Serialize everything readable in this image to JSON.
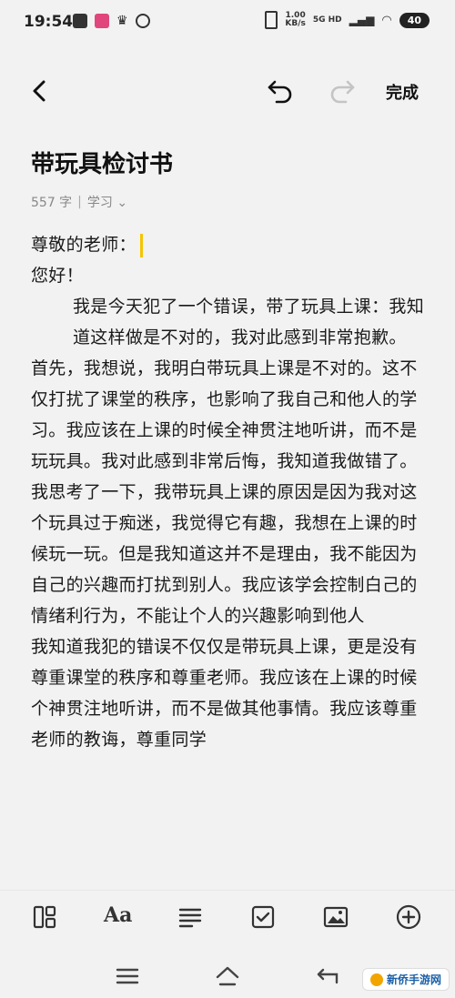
{
  "status": {
    "time": "19:54",
    "speed_value": "1.00",
    "speed_unit": "KB/s",
    "network": "5G HD",
    "battery": "40"
  },
  "toolbar": {
    "done_label": "完成"
  },
  "document": {
    "title": "带玩具检讨书",
    "word_count": "557 字",
    "category": "学习",
    "salutation": "尊敬的老师：",
    "greeting": "您好！",
    "paragraphs": [
      "我是今天犯了一个错误，带了玩具上课：我知道这样做是不对的，我对此感到非常抱歉。",
      "首先，我想说，我明白带玩具上课是不对的。这不仅打扰了课堂的秩序，也影响了我自己和他人的学习。我应该在上课的时候全神贯注地听讲，而不是玩玩具。我对此感到非常后悔，我知道我做错了。",
      "我思考了一下，我带玩具上课的原因是因为我对这个玩具过于痴迷，我觉得它有趣，我想在上课的时候玩一玩。但是我知道这并不是理由，我不能因为自己的兴趣而打扰到别人。我应该学会控制白己的情绪利行为，不能让个人的兴趣影响到他人",
      "我知道我犯的错误不仅仅是带玩具上课，更是没有尊重课堂的秩序和尊重老师。我应该在上课的时候个神贯注地听讲，而不是做其他事情。我应该尊重老师的教诲，尊重同学"
    ]
  },
  "watermark": {
    "text": "新侨手游网"
  },
  "colors": {
    "background": "#f2f2f2",
    "cursor": "#f5c400",
    "meta_text": "#888888"
  }
}
